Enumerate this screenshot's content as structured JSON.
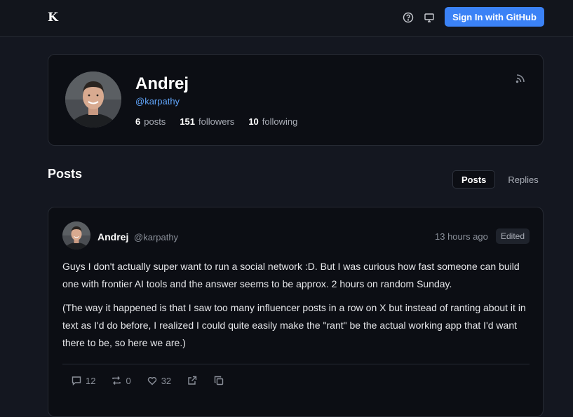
{
  "header": {
    "logo_text": "K",
    "signin_label": "Sign In with GitHub",
    "icons": [
      "help-circle-icon",
      "monitor-icon"
    ]
  },
  "profile": {
    "name": "Andrej",
    "handle": "@karpathy",
    "stats": {
      "posts_count": "6",
      "posts_label": "posts",
      "followers_count": "151",
      "followers_label": "followers",
      "following_count": "10",
      "following_label": "following"
    },
    "rss_icon": "rss-icon"
  },
  "section": {
    "title": "Posts",
    "tabs": [
      {
        "label": "Posts",
        "active": true
      },
      {
        "label": "Replies",
        "active": false
      }
    ]
  },
  "post": {
    "author": "Andrej",
    "handle": "@karpathy",
    "time": "13 hours ago",
    "edited_badge": "Edited",
    "paragraphs": [
      "Guys I don't actually super want to run a social network :D. But I was curious how fast someone can build one with frontier AI tools and the answer seems to be approx. 2 hours on random Sunday.",
      "(The way it happened is that I saw too many influencer posts in a row on X but instead of ranting about it in text as I'd do before, I realized I could quite easily make the \"rant\" be the actual working app that I'd want there to be, so here we are.)"
    ],
    "actions": {
      "replies": "12",
      "reposts": "0",
      "likes": "32"
    }
  },
  "colors": {
    "accent": "#3b82f6",
    "handle_link": "#60a5fa",
    "background": "#141720",
    "card": "#0c0e14"
  }
}
